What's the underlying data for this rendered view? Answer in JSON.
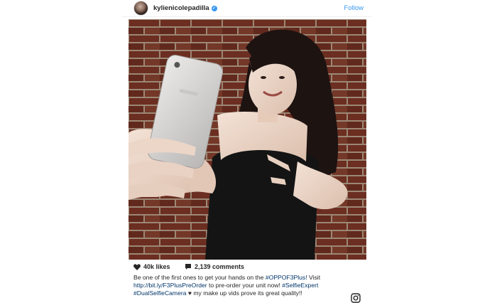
{
  "header": {
    "username": "kylienicolepadilla",
    "verified_icon": "verified-badge-icon",
    "follow_label": "Follow"
  },
  "post": {
    "image_alt": "Woman holding a silver smartphone up for a selfie and pointing at it, standing in front of a brick wall",
    "likes_icon": "heart-icon",
    "likes": "40k likes",
    "comments_icon": "comment-icon",
    "comments": "2,139 comments",
    "caption": {
      "text1": "Be one of the first ones to get your hands on the ",
      "hashtag1": "#OPPOF3Plus!",
      "text2": " Visit",
      "link": "http://bit.ly/F3PlusPreOrder",
      "text3": " to pre-order your unit now! ",
      "hashtag2": "#SelfieExpert",
      "hashtag3": "#DualSelfieCamera",
      "heart": "♥",
      "text4": " my make up vids prove its great quality!!"
    }
  },
  "footer": {
    "logo_icon": "instagram-logo-icon"
  },
  "colors": {
    "accent": "#3897f0",
    "text": "#262626",
    "brick": "#7a3526",
    "mortar": "#b29a86"
  }
}
